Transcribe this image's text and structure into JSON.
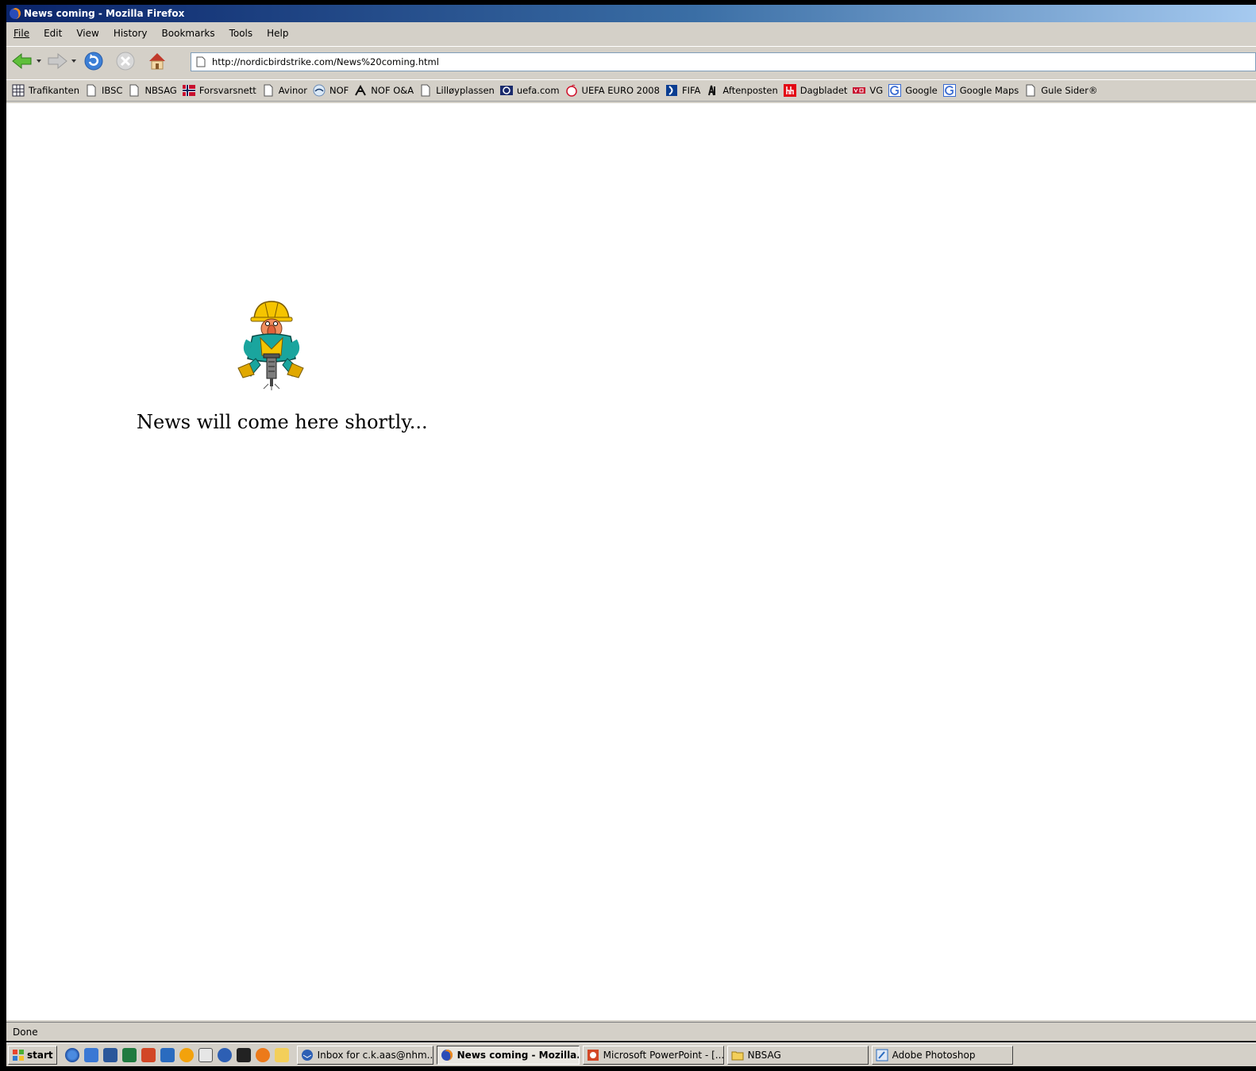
{
  "window": {
    "title": "News coming - Mozilla Firefox"
  },
  "menu": {
    "items": [
      {
        "label": "File"
      },
      {
        "label": "Edit"
      },
      {
        "label": "View"
      },
      {
        "label": "History"
      },
      {
        "label": "Bookmarks"
      },
      {
        "label": "Tools"
      },
      {
        "label": "Help"
      }
    ]
  },
  "navbar": {
    "url": "http://nordicbirdstrike.com/News%20coming.html"
  },
  "bookmarks": [
    {
      "label": "Trafikanten",
      "icon": "grid-icon"
    },
    {
      "label": "IBSC",
      "icon": "page-icon"
    },
    {
      "label": "NBSAG",
      "icon": "page-icon"
    },
    {
      "label": "Forsvarsnett",
      "icon": "norway-flag-icon"
    },
    {
      "label": "Avinor",
      "icon": "page-icon"
    },
    {
      "label": "NOF",
      "icon": "bird-icon"
    },
    {
      "label": "NOF O&A",
      "icon": "bird-icon"
    },
    {
      "label": "Lilløyplassen",
      "icon": "page-icon"
    },
    {
      "label": "uefa.com",
      "icon": "uefa-icon"
    },
    {
      "label": "UEFA EURO 2008",
      "icon": "euro-icon"
    },
    {
      "label": "FIFA",
      "icon": "fifa-icon"
    },
    {
      "label": "Aftenposten",
      "icon": "aftenposten-icon"
    },
    {
      "label": "Dagbladet",
      "icon": "dagbladet-icon"
    },
    {
      "label": "VG",
      "icon": "vg-icon"
    },
    {
      "label": "Google",
      "icon": "google-icon"
    },
    {
      "label": "Google Maps",
      "icon": "google-icon"
    },
    {
      "label": "Gule Sider®",
      "icon": "page-icon"
    }
  ],
  "content": {
    "message": "News will come here shortly..."
  },
  "status": {
    "text": "Done"
  },
  "taskbar": {
    "start_label": "start",
    "tasks": [
      {
        "label": "Inbox for c.k.aas@nhm....",
        "active": false
      },
      {
        "label": "News coming - Mozilla...",
        "active": true
      },
      {
        "label": "Microsoft PowerPoint - [...",
        "active": false
      },
      {
        "label": "NBSAG",
        "active": false
      },
      {
        "label": "Adobe Photoshop",
        "active": false
      }
    ]
  }
}
